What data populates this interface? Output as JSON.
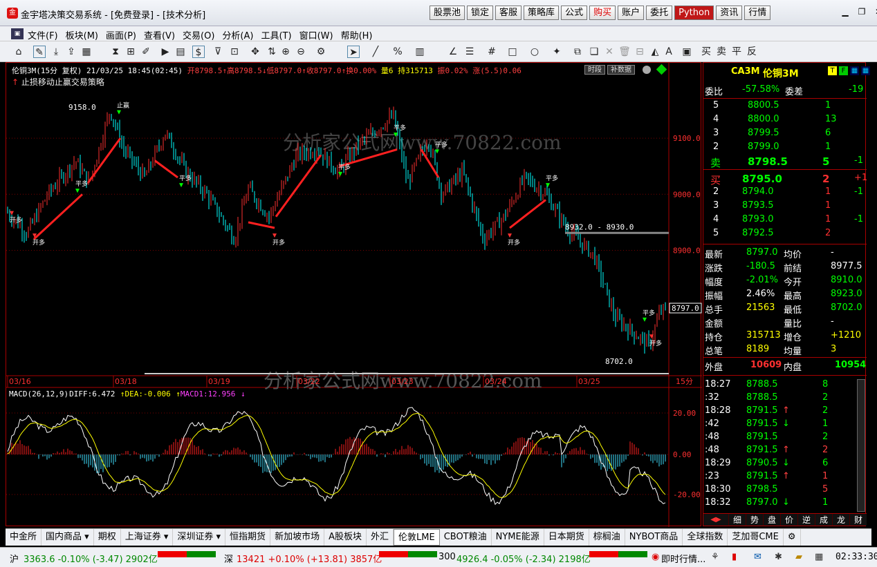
{
  "app": {
    "title": "金宇塔决策交易系统 - [免费登录] - [技术分析]"
  },
  "top_buttons": [
    {
      "label": "股票池"
    },
    {
      "label": "锁定"
    },
    {
      "label": "客服"
    },
    {
      "label": "策略库"
    },
    {
      "label": "公式"
    },
    {
      "label": "购买",
      "red": true
    },
    {
      "label": "账户"
    },
    {
      "label": "委托"
    },
    {
      "label": "Python",
      "py": true
    },
    {
      "label": "资讯"
    },
    {
      "label": "行情"
    }
  ],
  "menu": [
    "文件(F)",
    "板块(M)",
    "画面(P)",
    "查看(V)",
    "交易(O)",
    "分析(A)",
    "工具(T)",
    "窗口(W)",
    "帮助(H)"
  ],
  "chart": {
    "info": [
      {
        "t": "伦铜3M(15分 复权) 21/03/25 18:45(02:45) ",
        "c": "#ffffff"
      },
      {
        "t": "开8798.5",
        "c": "#ff4040"
      },
      {
        "t": "↑",
        "c": "#ff4040"
      },
      {
        "t": "高8798.5",
        "c": "#ff4040"
      },
      {
        "t": "↓",
        "c": "#ff4040"
      },
      {
        "t": "低8797.0",
        "c": "#ff4040"
      },
      {
        "t": "↑",
        "c": "#ff4040"
      },
      {
        "t": "收8797.0",
        "c": "#ff4040"
      },
      {
        "t": "↑",
        "c": "#ff4040"
      },
      {
        "t": "换0.00%",
        "c": "#ff4040"
      },
      {
        "t": " 量6",
        "c": "#ffff00"
      },
      {
        "t": " 持315713",
        "c": "#ffff00"
      },
      {
        "t": " 振0.02%",
        "c": "#ff4040"
      },
      {
        "t": " 涨(5.5)0.06",
        "c": "#ff4040"
      }
    ],
    "tabs": [
      "时段",
      "补数据"
    ],
    "strategy": "止损移动止赢交易策略",
    "price_ticks": [
      {
        "v": 9100,
        "label": "9100.0"
      },
      {
        "v": 9000,
        "label": "9000.0"
      },
      {
        "v": 8900,
        "label": "8900.0"
      }
    ],
    "price_range": [
      8680,
      9200
    ],
    "max_label": "9158.0",
    "min_label": "8702.0",
    "support_label": "8932.0 - 8930.0",
    "last_price": "8797.0",
    "dates": [
      "03/16",
      "03/18",
      "03/19",
      "03/22",
      "03/23",
      "03/24",
      "03/25"
    ],
    "period": "15分",
    "watermark1": "分析家公式网www.70822.com",
    "watermark2": "分析家公式网www.70822.com",
    "macd_legend": [
      {
        "t": "MACD(26,12,9)",
        "c": "#ffffff"
      },
      {
        "t": " DIFF:6.472",
        "c": "#ffffff"
      },
      {
        "t": "↑",
        "c": "#ffff00"
      },
      {
        "t": " DEA:-0.006",
        "c": "#ffff00"
      },
      {
        "t": "↑",
        "c": "#ffff00"
      },
      {
        "t": " MACD1:12.956",
        "c": "#ff40ff"
      },
      {
        "t": "↓",
        "c": "#ff40ff"
      }
    ],
    "macd_ticks": [
      "20.00",
      "0.00",
      "-20.00"
    ],
    "signal_labels": [
      "开多",
      "平多",
      "止赢"
    ]
  },
  "quote": {
    "symbol": "CA3M",
    "name": "伦铜3M",
    "weibi_label": "委比",
    "weibi": "-57.58%",
    "weicha_label": "委差",
    "weicha": "-19",
    "asks": [
      {
        "lv": "5",
        "p": "8800.5",
        "v": "1",
        "d": ""
      },
      {
        "lv": "4",
        "p": "8800.0",
        "v": "13",
        "d": ""
      },
      {
        "lv": "3",
        "p": "8799.5",
        "v": "6",
        "d": ""
      },
      {
        "lv": "2",
        "p": "8799.0",
        "v": "1",
        "d": ""
      },
      {
        "lv": "卖",
        "p": "8798.5",
        "v": "5",
        "d": "-1"
      }
    ],
    "bids": [
      {
        "lv": "买",
        "p": "8795.0",
        "v": "2",
        "d": "+1"
      },
      {
        "lv": "2",
        "p": "8794.0",
        "v": "1",
        "d": "-1"
      },
      {
        "lv": "3",
        "p": "8793.5",
        "v": "1",
        "d": ""
      },
      {
        "lv": "4",
        "p": "8793.0",
        "v": "1",
        "d": "-1"
      },
      {
        "lv": "5",
        "p": "8792.5",
        "v": "2",
        "d": ""
      }
    ],
    "stats": [
      {
        "l1": "最新",
        "v1": "8797.0",
        "c1": "#00ff00",
        "l2": "均价",
        "v2": "-",
        "c2": "#ffffff"
      },
      {
        "l1": "涨跌",
        "v1": "-180.5",
        "c1": "#00ff00",
        "l2": "前结",
        "v2": "8977.5",
        "c2": "#ffffff"
      },
      {
        "l1": "幅度",
        "v1": "-2.01%",
        "c1": "#00ff00",
        "l2": "今开",
        "v2": "8910.0",
        "c2": "#00ff00"
      },
      {
        "l1": "振幅",
        "v1": "2.46%",
        "c1": "#ffffff",
        "l2": "最高",
        "v2": "8923.0",
        "c2": "#00ff00"
      },
      {
        "l1": "总手",
        "v1": "21563",
        "c1": "#ffff00",
        "l2": "最低",
        "v2": "8702.0",
        "c2": "#00ff00"
      },
      {
        "l1": "金额",
        "v1": "",
        "c1": "#ffffff",
        "l2": "量比",
        "v2": "-",
        "c2": "#ffffff"
      },
      {
        "l1": "持仓",
        "v1": "315713",
        "c1": "#ffff00",
        "l2": "增仓",
        "v2": "+1210",
        "c2": "#ffff00"
      },
      {
        "l1": "总笔",
        "v1": "8189",
        "c1": "#ffff00",
        "l2": "均量",
        "v2": "3",
        "c2": "#ffff00"
      }
    ],
    "waipan_label": "外盘",
    "waipan": "10609",
    "neipan_label": "内盘",
    "neipan": "10954",
    "ticks": [
      {
        "t": "18:27",
        "p": "8788.5",
        "a": "",
        "v": "8",
        "vc": "#00ff00"
      },
      {
        "t": ":32",
        "p": "8788.5",
        "a": "",
        "v": "2",
        "vc": "#00ff00"
      },
      {
        "t": "18:28",
        "p": "8791.5",
        "a": "↑",
        "ac": "#ff4040",
        "v": "2",
        "vc": "#00ff00"
      },
      {
        "t": ":42",
        "p": "8791.5",
        "a": "↓",
        "ac": "#00ff00",
        "v": "1",
        "vc": "#00ff00"
      },
      {
        "t": ":48",
        "p": "8791.5",
        "a": "",
        "v": "2",
        "vc": "#00ff00"
      },
      {
        "t": ":48",
        "p": "8791.5",
        "a": "↑",
        "ac": "#ff4040",
        "v": "2",
        "vc": "#ff4040"
      },
      {
        "t": "18:29",
        "p": "8790.5",
        "a": "↓",
        "ac": "#00ff00",
        "v": "6",
        "vc": "#00ff00"
      },
      {
        "t": ":23",
        "p": "8791.5",
        "a": "↑",
        "ac": "#ff4040",
        "v": "1",
        "vc": "#ff4040"
      },
      {
        "t": "18:30",
        "p": "8798.5",
        "a": "",
        "v": "5",
        "vc": "#ff4040"
      },
      {
        "t": "18:32",
        "p": "8797.0",
        "a": "↓",
        "ac": "#00ff00",
        "v": "1",
        "vc": "#00ff00"
      }
    ],
    "panel_tabs": [
      "细",
      "势",
      "盘",
      "价",
      "逆",
      "成",
      "龙",
      "财"
    ]
  },
  "bottom_tabs": [
    "中金所",
    "国内商品 ▾",
    "期权",
    "上海证券 ▾",
    "深圳证券 ▾",
    "恒指期货",
    "新加坡市场",
    "A股板块",
    "外汇",
    "伦敦LME",
    "CBOT粮油",
    "NYME能源",
    "日本期货",
    "棕榈油",
    "NYBOT商品",
    "全球指数",
    "芝加哥CME"
  ],
  "active_tab": "伦敦LME",
  "status": {
    "sh_label": "沪",
    "sh": "3363.6 -0.10% (-3.47) 2902亿",
    "sz_label": "深",
    "sz": "13421 +0.10% (+13.81) 3857亿",
    "i300_label": "300",
    "i300": "4926.4 -0.05% (-2.34) 2198亿",
    "news": "即时行情...",
    "time": "02:33:30"
  },
  "colors": {
    "up": "#ff3030",
    "down": "#00ffff",
    "grid": "#7a0000",
    "yellow": "#ffff00",
    "green": "#00ff00"
  }
}
